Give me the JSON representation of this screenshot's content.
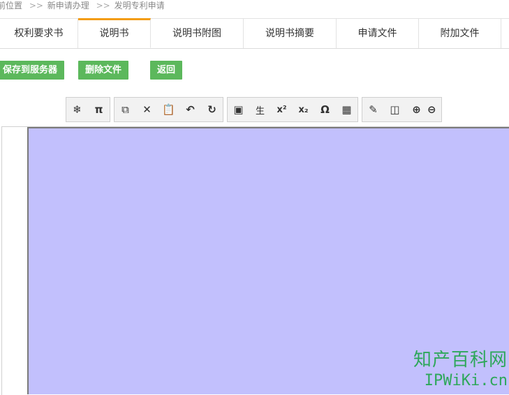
{
  "breadcrumb": {
    "items": [
      "前位置",
      "新申请办理",
      "发明专利申请"
    ],
    "separator": ">>"
  },
  "tabs": [
    {
      "label": "权利要求书",
      "active": false
    },
    {
      "label": "说明书",
      "active": true
    },
    {
      "label": "说明书附图",
      "active": false
    },
    {
      "label": "说明书摘要",
      "active": false
    },
    {
      "label": "申请文件",
      "active": false
    },
    {
      "label": "附加文件",
      "active": false
    }
  ],
  "actions": {
    "save_label": "保存到服务器",
    "delete_label": "删除文件",
    "back_label": "返回"
  },
  "toolbar": {
    "groups": [
      [
        {
          "icon": "snowflake-icon",
          "glyph": "❄"
        },
        {
          "icon": "pi-icon",
          "glyph": "π"
        }
      ],
      [
        {
          "icon": "copy-icon",
          "glyph": "⧉"
        },
        {
          "icon": "cut-icon",
          "glyph": "✕"
        },
        {
          "icon": "paste-icon",
          "glyph": "📋"
        },
        {
          "icon": "undo-icon",
          "glyph": "↶"
        },
        {
          "icon": "redo-icon",
          "glyph": "↻"
        }
      ],
      [
        {
          "icon": "image-icon",
          "glyph": "▣"
        },
        {
          "icon": "rare-char-icon",
          "glyph": "生"
        },
        {
          "icon": "superscript-icon",
          "glyph": "x²"
        },
        {
          "icon": "subscript-icon",
          "glyph": "x₂"
        },
        {
          "icon": "omega-icon",
          "glyph": "Ω"
        },
        {
          "icon": "table-icon",
          "glyph": "▦"
        }
      ],
      [
        {
          "icon": "spellcheck-icon",
          "glyph": "✎"
        },
        {
          "icon": "fullscreen-icon",
          "glyph": "◫"
        },
        {
          "icon": "zoom-in-icon",
          "glyph": "⊕"
        },
        {
          "icon": "zoom-out-icon",
          "glyph": "⊖"
        }
      ]
    ]
  },
  "watermark": {
    "line1": "知产百科网",
    "line2": "IPWiKi.cn"
  },
  "colors": {
    "accent_tab": "#f39c12",
    "button_green": "#5cb85c",
    "editor_bg": "#c2c0fd",
    "watermark": "#2ea75a"
  }
}
